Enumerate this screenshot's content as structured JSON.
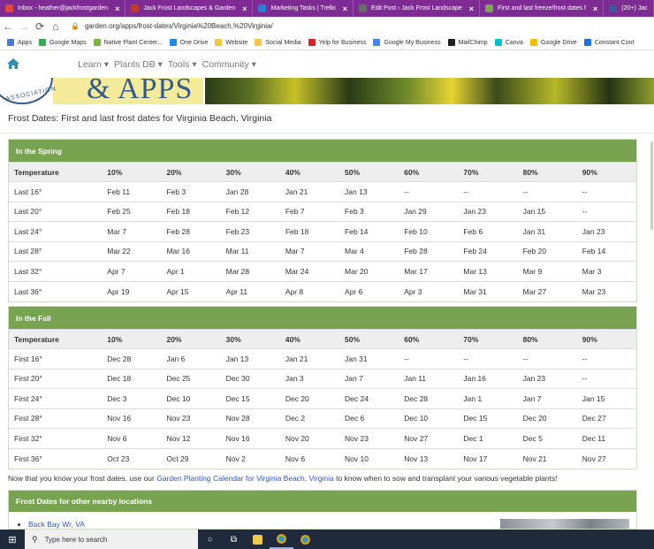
{
  "browser": {
    "tabs": [
      {
        "label": "Inbox - heather@jackfrostgarden",
        "color": "#e0463a",
        "active": false
      },
      {
        "label": "Jack Frost Landscapes & Garden",
        "color": "#c0392b",
        "active": false
      },
      {
        "label": "Marketing Tasks | Trello",
        "color": "#2d7bd6",
        "active": false
      },
      {
        "label": "Edit Post ‹ Jack Frost Landscape",
        "color": "#6a6a6a",
        "active": false
      },
      {
        "label": "First and last freeze/frost dates f",
        "color": "#7aa653",
        "active": false
      },
      {
        "label": "(20+) Jac",
        "color": "#3b5998",
        "active": false
      }
    ],
    "close_glyph": "×",
    "url": "garden.org/apps/frost-dates/Virginia%20Beach,%20Virginia/",
    "bookmarks": [
      {
        "label": "Apps",
        "color": "#4a7bd0"
      },
      {
        "label": "Google Maps",
        "color": "#34a853"
      },
      {
        "label": "Native Plant Center...",
        "color": "#7cb342"
      },
      {
        "label": "One Drive",
        "color": "#1e88e5"
      },
      {
        "label": "Website",
        "color": "#f4c542"
      },
      {
        "label": "Social Media",
        "color": "#f4c542"
      },
      {
        "label": "Yelp for Business",
        "color": "#d32323"
      },
      {
        "label": "Google My Business",
        "color": "#4285f4"
      },
      {
        "label": "MailChimp",
        "color": "#222222"
      },
      {
        "label": "Canva",
        "color": "#00c4cc"
      },
      {
        "label": "Google Drive",
        "color": "#fbbc05"
      },
      {
        "label": "Constant Cont",
        "color": "#1a73e8"
      }
    ]
  },
  "site": {
    "menu": [
      "Learn ▾",
      "Plants DB ▾",
      "Tools ▾",
      "Community ▾"
    ],
    "logo_text": "& APPS",
    "logo_arc": "ASSOCIATION"
  },
  "page": {
    "title": "Frost Dates: First and last frost dates for Virginia Beach, Virginia",
    "spring": {
      "heading": "In the Spring",
      "columns": [
        "Temperature",
        "10%",
        "20%",
        "30%",
        "40%",
        "50%",
        "60%",
        "70%",
        "80%",
        "90%"
      ],
      "rows": [
        [
          "Last 16°",
          "Feb 11",
          "Feb 3",
          "Jan 28",
          "Jan 21",
          "Jan 13",
          "--",
          "--",
          "--",
          "--"
        ],
        [
          "Last 20°",
          "Feb 25",
          "Feb 18",
          "Feb 12",
          "Feb 7",
          "Feb 3",
          "Jan 29",
          "Jan 23",
          "Jan 15",
          "--"
        ],
        [
          "Last 24°",
          "Mar 7",
          "Feb 28",
          "Feb 23",
          "Feb 18",
          "Feb 14",
          "Feb 10",
          "Feb 6",
          "Jan 31",
          "Jan 23"
        ],
        [
          "Last 28°",
          "Mar 22",
          "Mar 16",
          "Mar 11",
          "Mar 7",
          "Mar 4",
          "Feb 28",
          "Feb 24",
          "Feb 20",
          "Feb 14"
        ],
        [
          "Last 32°",
          "Apr 7",
          "Apr 1",
          "Mar 28",
          "Mar 24",
          "Mar 20",
          "Mar 17",
          "Mar 13",
          "Mar 9",
          "Mar 3"
        ],
        [
          "Last 36°",
          "Apr 19",
          "Apr 15",
          "Apr 11",
          "Apr 8",
          "Apr 6",
          "Apr 3",
          "Mar 31",
          "Mar 27",
          "Mar 23"
        ]
      ]
    },
    "fall": {
      "heading": "In the Fall",
      "columns": [
        "Temperature",
        "10%",
        "20%",
        "30%",
        "40%",
        "50%",
        "60%",
        "70%",
        "80%",
        "90%"
      ],
      "rows": [
        [
          "First 16°",
          "Dec 28",
          "Jan 6",
          "Jan 13",
          "Jan 21",
          "Jan 31",
          "--",
          "--",
          "--",
          "--"
        ],
        [
          "First 20°",
          "Dec 18",
          "Dec 25",
          "Dec 30",
          "Jan 3",
          "Jan 7",
          "Jan 11",
          "Jan 16",
          "Jan 23",
          "--"
        ],
        [
          "First 24°",
          "Dec 3",
          "Dec 10",
          "Dec 15",
          "Dec 20",
          "Dec 24",
          "Dec 28",
          "Jan 1",
          "Jan 7",
          "Jan 15"
        ],
        [
          "First 28°",
          "Nov 16",
          "Nov 23",
          "Nov 28",
          "Dec 2",
          "Dec 6",
          "Dec 10",
          "Dec 15",
          "Dec 20",
          "Dec 27"
        ],
        [
          "First 32°",
          "Nov 6",
          "Nov 12",
          "Nov 16",
          "Nov 20",
          "Nov 23",
          "Nov 27",
          "Dec 1",
          "Dec 5",
          "Dec 11"
        ],
        [
          "First 36°",
          "Oct 23",
          "Oct 29",
          "Nov 2",
          "Nov 6",
          "Nov 10",
          "Nov 13",
          "Nov 17",
          "Nov 21",
          "Nov 27"
        ]
      ]
    },
    "note_before": "Now that you know your frost dates, use our ",
    "note_link": "Garden Planting Calendar for Virginia Beach, Virginia",
    "note_after": " to know when to sow and transplant your various vegetable plants!",
    "nearby": {
      "heading": "Frost Dates for other nearby locations",
      "items": [
        "Back Bay Wr, VA"
      ]
    }
  },
  "taskbar": {
    "search_placeholder": "Type here to search",
    "windows_glyph": "⊞",
    "search_glyph": "⚲"
  },
  "theme": {
    "tabbar": "#7e2c93",
    "panel_header": "#78a452",
    "link": "#2b56c8",
    "taskbar": "#1f2a3d"
  }
}
